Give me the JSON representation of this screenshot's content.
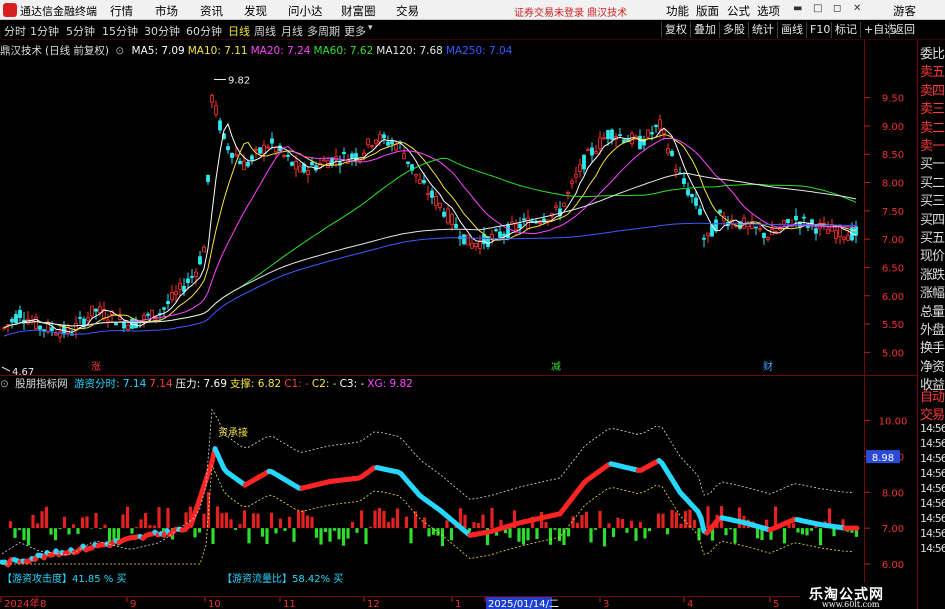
{
  "titlebar": {
    "app_title": "通达信金融终端",
    "menus": [
      "行情",
      "市场",
      "资讯",
      "发现",
      "问小达",
      "财富圈",
      "交易"
    ],
    "notice": "证券交易未登录  鼎汉技术",
    "right_menus": [
      "功能",
      "版面",
      "公式",
      "选项"
    ],
    "user": "游客"
  },
  "toolbar": {
    "periods": [
      "分时",
      "1分钟",
      "5分钟",
      "15分钟",
      "30分钟",
      "60分钟",
      "日线",
      "周线",
      "月线",
      "多周期",
      "更多"
    ],
    "active_period": "日线",
    "buttons": [
      "复权",
      "叠加",
      "多股",
      "统计",
      "画线",
      "F10",
      "标记",
      "+自选",
      "返回"
    ]
  },
  "main_chart": {
    "stock_label": "鼎汉技术",
    "period_label": "(日线 前复权)",
    "ma": [
      {
        "label": "MA5: 7.09",
        "color": "#ffffff"
      },
      {
        "label": "MA10: 7.11",
        "color": "#f5e342"
      },
      {
        "label": "MA20: 7.24",
        "color": "#ff44ff"
      },
      {
        "label": "MA60: 7.62",
        "color": "#2ee02e"
      },
      {
        "label": "MA120: 7.68",
        "color": "#e6e6e6"
      },
      {
        "label": "MA250: 7.04",
        "color": "#3a5cff"
      }
    ],
    "y_ticks": [
      "9.50",
      "9.00",
      "8.50",
      "8.00",
      "7.50",
      "7.00",
      "6.50",
      "6.00",
      "5.50",
      "5.00"
    ],
    "high_label": "9.82",
    "low_label": "4.67",
    "markers": [
      {
        "text": "涨",
        "color": "#ff3b3b"
      },
      {
        "text": "减",
        "color": "#2ee02e"
      },
      {
        "text": "财",
        "color": "#4aa0ff"
      }
    ]
  },
  "indicator": {
    "name": "股朋指标网",
    "items": [
      {
        "label": "游资分时: 7.14",
        "color": "#26d7ff"
      },
      {
        "label": "7.14",
        "color": "#ff3b3b"
      },
      {
        "label": "压力: 7.69",
        "color": "#ffffff"
      },
      {
        "label": "支撑: 6.82",
        "color": "#f5e342"
      },
      {
        "label": "C1: -",
        "color": "#ff3b3b"
      },
      {
        "label": "C2: -",
        "color": "#f5e342"
      },
      {
        "label": "C3: -",
        "color": "#ffffff"
      },
      {
        "label": "XG: 9.82",
        "color": "#ff44ff"
      }
    ],
    "y_ticks": [
      "10.00",
      "9.00",
      "8.00",
      "7.00",
      "6.00"
    ],
    "current_value": "8.98",
    "annotation": "资承接",
    "bottom_label_1": "【游资攻击度】41.85 % 买",
    "bottom_label_2": "【游资流量比】58.42% 买",
    "right_ticks": [
      "14:56",
      "14:56",
      "14:56",
      "14:56",
      "14:56",
      "14:56",
      "14:56",
      "14:56",
      "14:56"
    ]
  },
  "time_axis": {
    "labels": [
      "2024年",
      "8",
      "9",
      "10",
      "11",
      "12",
      "1",
      "2025/01/14/二",
      "3",
      "4",
      "5"
    ]
  },
  "sidebar": {
    "items": [
      "委比",
      "卖五",
      "卖四",
      "卖三",
      "卖二",
      "卖一",
      "买一",
      "买二",
      "买三",
      "买四",
      "买五",
      "现价",
      "涨跌",
      "涨幅",
      "总量",
      "外盘",
      "换手",
      "净资",
      "收益"
    ],
    "items_lower": [
      "自动",
      "交易"
    ]
  },
  "watermark": {
    "title": "乐淘公式网",
    "url": "www.60lt.com"
  }
}
